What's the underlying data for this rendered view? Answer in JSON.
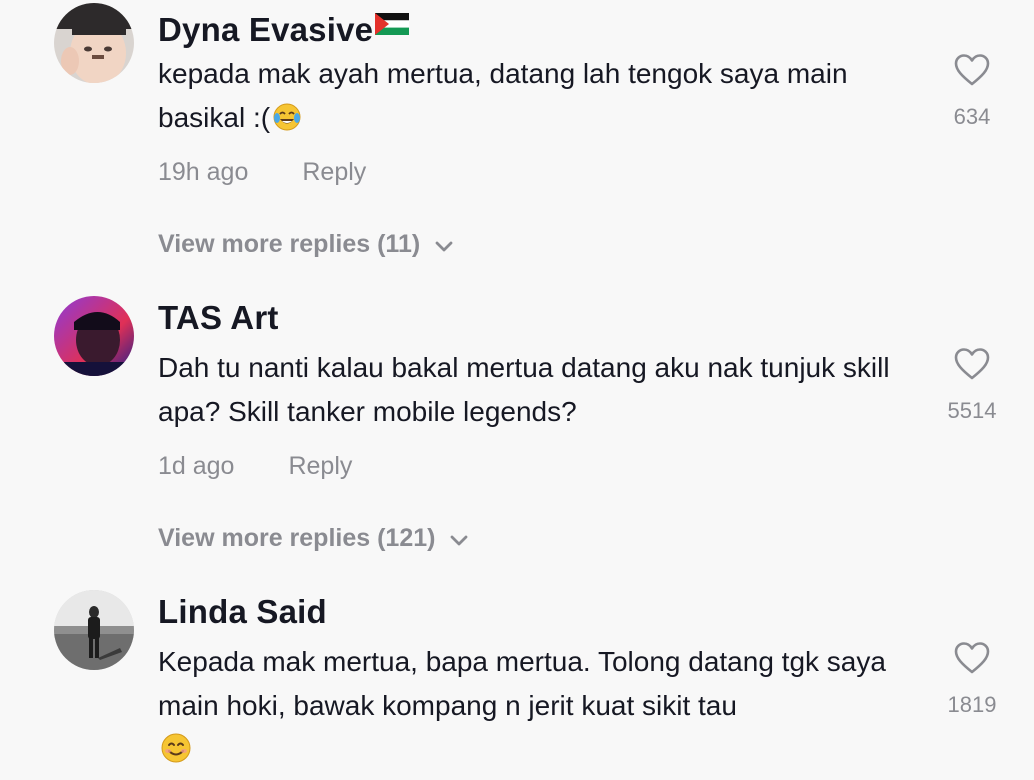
{
  "comments": [
    {
      "username": "Dyna Evasive",
      "username_flag_icon": "palestine-flag-icon",
      "text": "kepada mak ayah mertua, datang lah tengok saya main basikal :(",
      "text_emoji": "face-with-tears-of-joy-emoji",
      "time": "19h ago",
      "reply_label": "Reply",
      "view_more": "View more replies (11)",
      "likes": "634"
    },
    {
      "username": "TAS Art",
      "text": "Dah tu nanti kalau bakal mertua datang aku nak tunjuk skill apa? Skill tanker mobile legends?",
      "time": "1d ago",
      "reply_label": "Reply",
      "view_more": "View more replies (121)",
      "likes": "5514"
    },
    {
      "username": "Linda Said",
      "text": "Kepada mak mertua, bapa mertua. Tolong datang tgk saya main hoki, bawak kompang n jerit kuat sikit tau",
      "text_emoji": "smiling-face-emoji",
      "likes": "1819"
    }
  ],
  "colors": {
    "background": "#f8f8f8",
    "username": "#161823",
    "secondary_text": "#8a8b91"
  }
}
